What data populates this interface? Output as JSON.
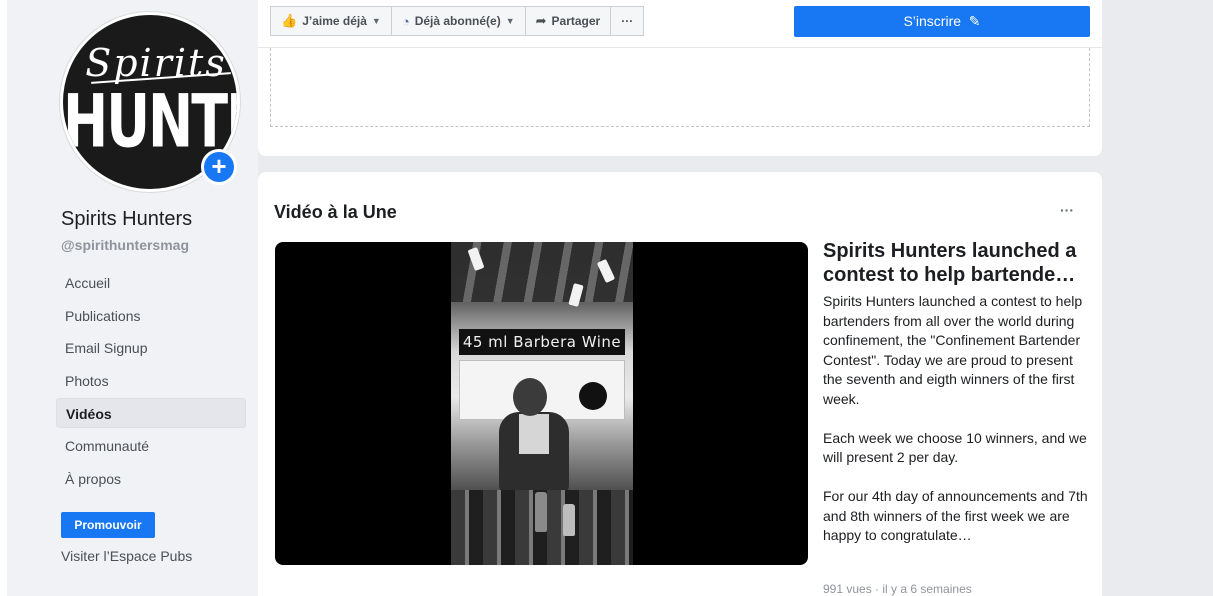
{
  "sidebar": {
    "page_name": "Spirits Hunters",
    "handle": "@spirithuntersmag",
    "logo": {
      "script_text": "Spirits",
      "main_text": "HUNTERS"
    },
    "nav_items": [
      {
        "label": "Accueil",
        "active": false
      },
      {
        "label": "Publications",
        "active": false
      },
      {
        "label": "Email Signup",
        "active": false
      },
      {
        "label": "Photos",
        "active": false
      },
      {
        "label": "Vidéos",
        "active": true
      },
      {
        "label": "Communauté",
        "active": false
      },
      {
        "label": "À propos",
        "active": false
      }
    ],
    "promote_label": "Promouvoir",
    "ads_link": "Visiter l’Espace Pubs"
  },
  "action_bar": {
    "like_label": "J’aime déjà",
    "follow_label": "Déjà abonné(e)",
    "share_label": "Partager",
    "more_label": "···",
    "subscribe_label": "S’inscrire"
  },
  "featured_video": {
    "section_title": "Vidéo à la Une",
    "more_label": "···",
    "caption": "45 ml Barbera Wine",
    "headline": "Spirits Hunters launched a contest to help bartende…",
    "paragraphs": [
      "Spirits Hunters launched a contest to help bartenders from all over the world during confinement, the \"Confinement Bartender Contest\". Today we are proud to present the seventh and eigth winners of the first week.",
      "Each week we choose 10 winners, and we will present 2 per day.",
      "For our 4th day of announcements and 7th and 8th winners of the first week we are happy to congratulate…"
    ],
    "meta": "991 vues · il y a 6 semaines"
  },
  "colors": {
    "accent": "#1877f2",
    "background": "#e9ebee",
    "card": "#ffffff"
  }
}
